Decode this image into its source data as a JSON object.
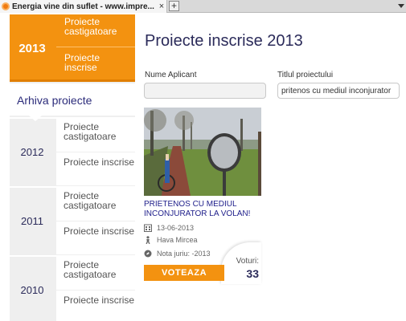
{
  "browser": {
    "tab_title": "Energia vine din suflet - www.impre...",
    "close_glyph": "×",
    "new_tab_glyph": "+"
  },
  "sidebar": {
    "active_year": {
      "year": "2013",
      "items": [
        "Proiecte castigatoare",
        "Proiecte inscrise"
      ]
    },
    "archive_label": "Arhiva proiecte",
    "archive_years": [
      {
        "year": "2012",
        "items": [
          "Proiecte castigatoare",
          "Proiecte inscrise"
        ]
      },
      {
        "year": "2011",
        "items": [
          "Proiecte castigatoare",
          "Proiecte inscrise"
        ]
      },
      {
        "year": "2010",
        "items": [
          "Proiecte castigatoare",
          "Proiecte inscrise"
        ]
      }
    ]
  },
  "main": {
    "title": "Proiecte inscrise 2013",
    "filters": {
      "applicant_label": "Nume Aplicant",
      "applicant_value": "",
      "project_label": "Titlul proiectului",
      "project_value": "pritenos cu mediul inconjurator"
    },
    "project": {
      "title": "PRIETENOS CU MEDIUL INCONJURATOR LA VOLAN!",
      "date": "13-06-2013",
      "author": "Hava Mircea",
      "jury_note": "Nota juriu: -2013",
      "vote_label": "VOTEAZA",
      "votes_label": "Voturi:",
      "votes_count": "33"
    }
  },
  "colors": {
    "accent_orange": "#f39210",
    "title_navy": "#2b2b5a",
    "link_blue": "#1e1e8a",
    "sidebar_gray": "#efefef"
  }
}
